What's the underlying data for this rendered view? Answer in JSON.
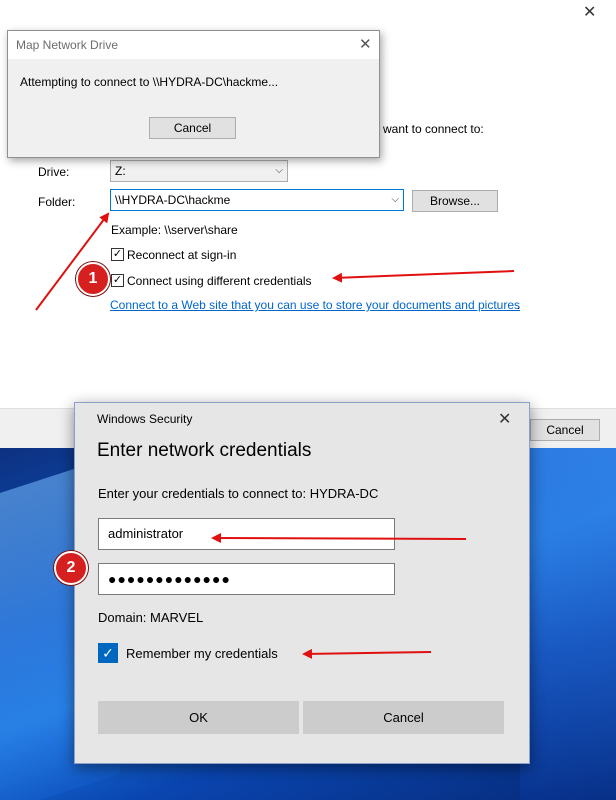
{
  "wizard": {
    "close_glyph": "✕",
    "connect_prompt": "want to connect to:",
    "drive_label": "Drive:",
    "drive_value": "Z:",
    "folder_label": "Folder:",
    "folder_value": "\\\\HYDRA-DC\\hackme",
    "browse_label": "Browse...",
    "example_text": "Example: \\\\server\\share",
    "reconnect_label": "Reconnect at sign-in",
    "reconnect_checked": true,
    "diff_creds_label": "Connect using different credentials",
    "diff_creds_checked": true,
    "web_link": "Connect to a Web site that you can use to store your documents and pictures",
    "web_link_suffix": ".",
    "cancel_label": "Cancel"
  },
  "popup": {
    "title": "Map Network Drive",
    "close_glyph": "✕",
    "message": "Attempting to connect to \\\\HYDRA-DC\\hackme...",
    "cancel_label": "Cancel"
  },
  "security": {
    "caption": "Windows Security",
    "close_glyph": "✕",
    "heading": "Enter network credentials",
    "subtitle": "Enter your credentials to connect to: HYDRA-DC",
    "username_value": "administrator",
    "password_value": "●●●●●●●●●●●●●",
    "domain_text": "Domain: MARVEL",
    "remember_label": "Remember my credentials",
    "remember_checked": true,
    "ok_label": "OK",
    "cancel_label": "Cancel"
  },
  "annotations": {
    "badge1": "1",
    "badge2": "2",
    "arrow_color": "#e01010"
  },
  "colors": {
    "accent": "#0067c0",
    "link": "#0066cc",
    "badge": "#d62020"
  }
}
